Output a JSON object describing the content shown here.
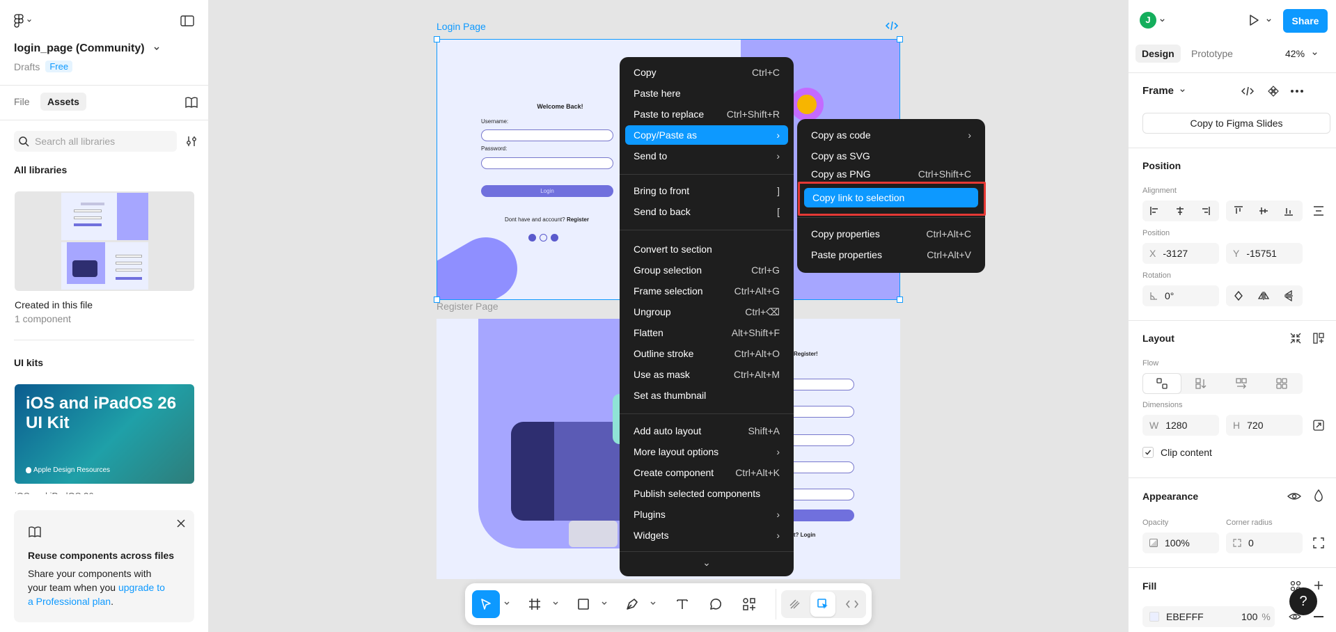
{
  "left": {
    "file_title": "login_page (Community)",
    "drafts": "Drafts",
    "plan_badge": "Free",
    "tabs": [
      "File",
      "Assets"
    ],
    "search_placeholder": "Search all libraries",
    "all_libraries": "All libraries",
    "created_title": "Created in this file",
    "created_sub": "1 component",
    "ui_kits": "UI kits",
    "kit_title_line1": "iOS and iPadOS 26",
    "kit_title_line2": "UI Kit",
    "kit_brand": "Apple Design Resources",
    "promo_title": "Reuse components across files",
    "promo_text_1": "Share your components with",
    "promo_text_2": "your team when you ",
    "promo_link_1": "upgrade to",
    "promo_link_2": "a Professional plan",
    "promo_dot": "."
  },
  "canvas": {
    "frame1_label": "Login Page",
    "frame2_label": "Register Page",
    "welcome": "Welcome Back!",
    "username": "Username:",
    "password": "Password:",
    "login_btn": "Login",
    "register_prompt": "Dont  have and account? ",
    "register_link": "Register",
    "register_title": "Register!",
    "login_prompt": "nt? Login"
  },
  "context_menu": {
    "items": [
      {
        "label": "Copy",
        "shortcut": "Ctrl+C"
      },
      {
        "label": "Paste here",
        "shortcut": ""
      },
      {
        "label": "Paste to replace",
        "shortcut": "Ctrl+Shift+R"
      },
      {
        "label": "Copy/Paste as",
        "shortcut": "›"
      },
      {
        "label": "Send to",
        "shortcut": "›"
      },
      {
        "label": "Bring to front",
        "shortcut": "]"
      },
      {
        "label": "Send to back",
        "shortcut": "["
      },
      {
        "label": "Convert to section",
        "shortcut": ""
      },
      {
        "label": "Group selection",
        "shortcut": "Ctrl+G"
      },
      {
        "label": "Frame selection",
        "shortcut": "Ctrl+Alt+G"
      },
      {
        "label": "Ungroup",
        "shortcut": "Ctrl+⌫"
      },
      {
        "label": "Flatten",
        "shortcut": "Alt+Shift+F"
      },
      {
        "label": "Outline stroke",
        "shortcut": "Ctrl+Alt+O"
      },
      {
        "label": "Use as mask",
        "shortcut": "Ctrl+Alt+M"
      },
      {
        "label": "Set as thumbnail",
        "shortcut": ""
      },
      {
        "label": "Add auto layout",
        "shortcut": "Shift+A"
      },
      {
        "label": "More layout options",
        "shortcut": "›"
      },
      {
        "label": "Create component",
        "shortcut": "Ctrl+Alt+K"
      },
      {
        "label": "Publish selected components",
        "shortcut": ""
      },
      {
        "label": "Plugins",
        "shortcut": "›"
      },
      {
        "label": "Widgets",
        "shortcut": "›"
      }
    ],
    "more": "⌄"
  },
  "submenu": {
    "items": [
      {
        "label": "Copy as code",
        "shortcut": "›"
      },
      {
        "label": "Copy as SVG",
        "shortcut": ""
      },
      {
        "label": "Copy as PNG",
        "shortcut": "Ctrl+Shift+C"
      },
      {
        "label": "Copy link to selection",
        "shortcut": ""
      },
      {
        "label": "Copy properties",
        "shortcut": "Ctrl+Alt+C"
      },
      {
        "label": "Paste properties",
        "shortcut": "Ctrl+Alt+V"
      }
    ]
  },
  "right": {
    "avatar_letter": "J",
    "share": "Share",
    "tabs": [
      "Design",
      "Prototype"
    ],
    "zoom": "42%",
    "frame_label": "Frame",
    "copy_slides": "Copy to Figma Slides",
    "position_title": "Position",
    "alignment_label": "Alignment",
    "position_label": "Position",
    "x_label": "X",
    "x_value": "-3127",
    "y_label": "Y",
    "y_value": "-15751",
    "rotation_label": "Rotation",
    "rotation_value": "0°",
    "layout_title": "Layout",
    "flow_label": "Flow",
    "dimensions_label": "Dimensions",
    "w_label": "W",
    "w_value": "1280",
    "h_label": "H",
    "h_value": "720",
    "clip_content": "Clip content",
    "appearance_title": "Appearance",
    "opacity_label": "Opacity",
    "opacity_value": "100%",
    "radius_label": "Corner radius",
    "radius_value": "0",
    "fill_title": "Fill",
    "fill_hex": "EBEFFF",
    "fill_opacity": "100",
    "fill_pct": "%",
    "help": "?"
  },
  "colors": {
    "accent": "#0d99ff",
    "menu_bg": "#1e1e1e",
    "highlight_box": "#e53935",
    "frame_fill": "#EBEFFF",
    "purple": "#a6a6ff"
  }
}
